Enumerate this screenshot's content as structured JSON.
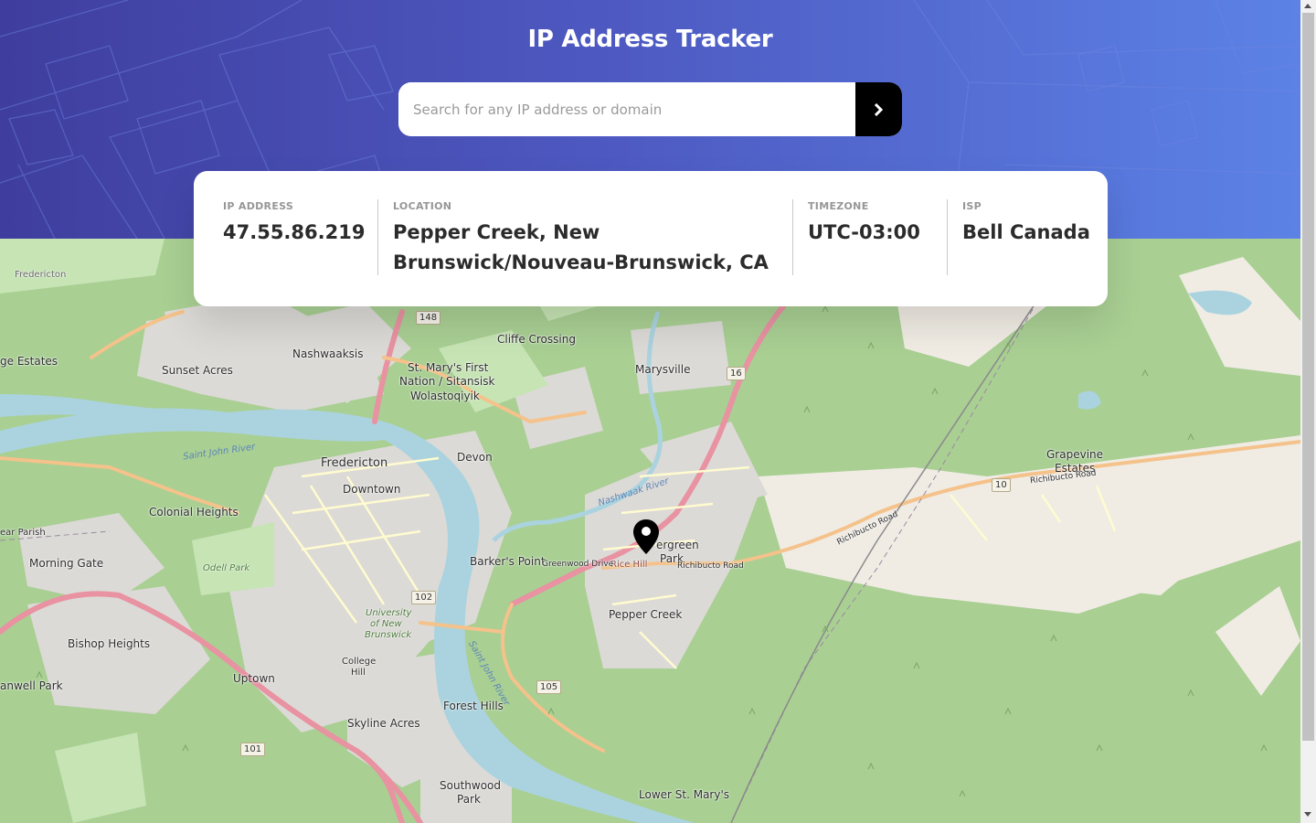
{
  "header": {
    "title": "IP Address Tracker"
  },
  "search": {
    "placeholder": "Search for any IP address or domain",
    "value": "",
    "submit_icon": "chevron-right-icon"
  },
  "info": {
    "ip_label": "IP ADDRESS",
    "ip_value": "47.55.86.219",
    "location_label": "LOCATION",
    "location_value": "Pepper Creek, New Brunswick/Nouveau-Brunswick, CA",
    "timezone_label": "TIMEZONE",
    "timezone_value": "UTC-03:00",
    "isp_label": "ISP",
    "isp_value": "Bell Canada"
  },
  "map": {
    "marker_icon": "location-pin-icon",
    "places": {
      "fredericton": "Fredericton",
      "downtown": "Downtown",
      "nashwaaksis": "Nashwaaksis",
      "sunset_acres": "Sunset Acres",
      "cliffe_crossing": "Cliffe Crossing",
      "marysville": "Marysville",
      "st_marys_1": "St. Mary's First",
      "st_marys_2": "Nation / Sitansisk",
      "st_marys_3": "Wolastoqiyik",
      "devon": "Devon",
      "colonial_heights": "Colonial Heights",
      "morning_gate": "Morning Gate",
      "bishop_heights": "Bishop Heights",
      "uptown": "Uptown",
      "barkers_point": "Barker's Point",
      "evergreen_park_1": "ergreen",
      "evergreen_park_2": "Park",
      "pepper_creek": "Pepper Creek",
      "forest_hills": "Forest Hills",
      "skyline_acres": "Skyline Acres",
      "southwood_park_1": "Southwood",
      "southwood_park_2": "Park",
      "lower_st_marys": "Lower St. Mary's",
      "grapevine_1": "Grapevine",
      "grapevine_2": "Estates",
      "ge_estates": "ge Estates",
      "anwell_park": "anwell Park",
      "ear_parish": "ear Parish",
      "fredericton_small": "Fredericton",
      "college_hill_1": "College",
      "college_hill_2": "Hill",
      "rice_hill": "Rice Hill",
      "saint_john_river": "Saint John River",
      "saint_john_river_2": "Saint John River",
      "nashwaak_river": "Nashwaak River",
      "odell_park": "Odell Park",
      "unb_1": "University",
      "unb_2": "of New",
      "unb_3": "Brunswick",
      "richibucto_road": "Richibucto Road",
      "richibucto_road_2": "Richibucto Road",
      "richibucto_road_3": "Richibucto Road",
      "greenwood_drive": "Greenwood Drive"
    },
    "shields": {
      "r148": "148",
      "r16": "16",
      "r10a": "10",
      "r102": "102",
      "r105": "105",
      "r101": "101"
    }
  }
}
